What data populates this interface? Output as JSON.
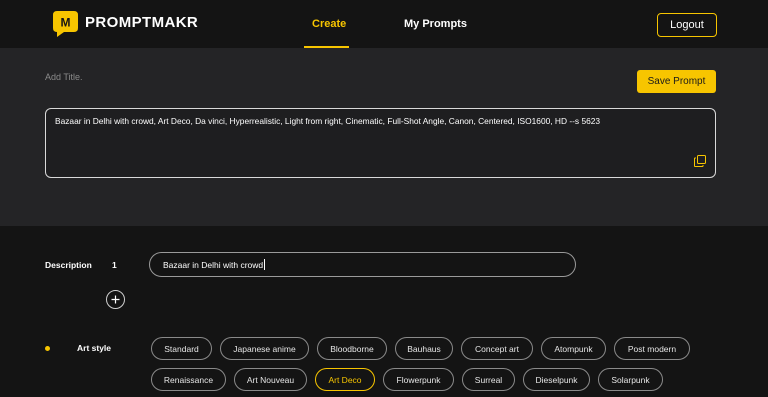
{
  "brand": {
    "logo_letter": "M",
    "name": "PROMPTMAKR",
    "accent": "#f7c500"
  },
  "nav": {
    "tabs": [
      {
        "label": "Create",
        "active": true
      },
      {
        "label": "My Prompts",
        "active": false
      }
    ],
    "logout_label": "Logout"
  },
  "editor": {
    "title_placeholder": "Add Title.",
    "save_label": "Save Prompt",
    "prompt_text": "Bazaar in Delhi with crowd, Art Deco, Da vinci, Hyperrealistic, Light from right, Cinematic, Full-Shot Angle, Canon, Centered, ISO1600, HD --s 5623",
    "copy_icon": "copy-icon"
  },
  "description": {
    "label": "Description",
    "index": "1",
    "value": "Bazaar in Delhi with crowd"
  },
  "add_icon": "plus-icon",
  "art_style": {
    "label": "Art style",
    "selected": "Art Deco",
    "options_row1": [
      "Standard",
      "Japanese anime",
      "Bloodborne",
      "Bauhaus",
      "Concept art",
      "Atompunk",
      "Post modern"
    ],
    "options_row2": [
      "Renaissance",
      "Art Nouveau",
      "Art Deco",
      "Flowerpunk",
      "Surreal",
      "Dieselpunk",
      "Solarpunk"
    ]
  }
}
